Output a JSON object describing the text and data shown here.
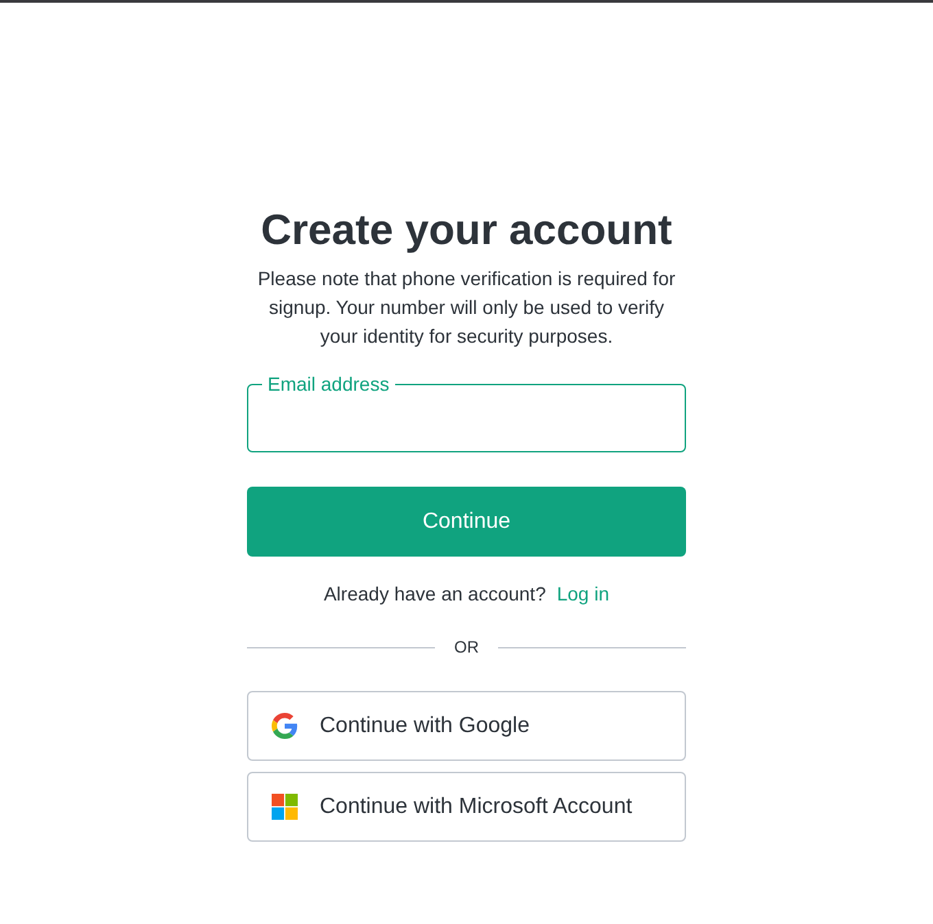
{
  "heading": "Create your account",
  "notice": "Please note that phone verification is required for signup. Your number will only be used to verify your identity for security purposes.",
  "email_field": {
    "label": "Email address",
    "focused": true
  },
  "continue_button": "Continue",
  "login_prompt": {
    "text": "Already have an account?",
    "link": "Log in"
  },
  "divider": "OR",
  "social_buttons": [
    {
      "kind": "google",
      "label": "Continue with Google"
    },
    {
      "kind": "microsoft",
      "label": "Continue with Microsoft Account"
    }
  ]
}
